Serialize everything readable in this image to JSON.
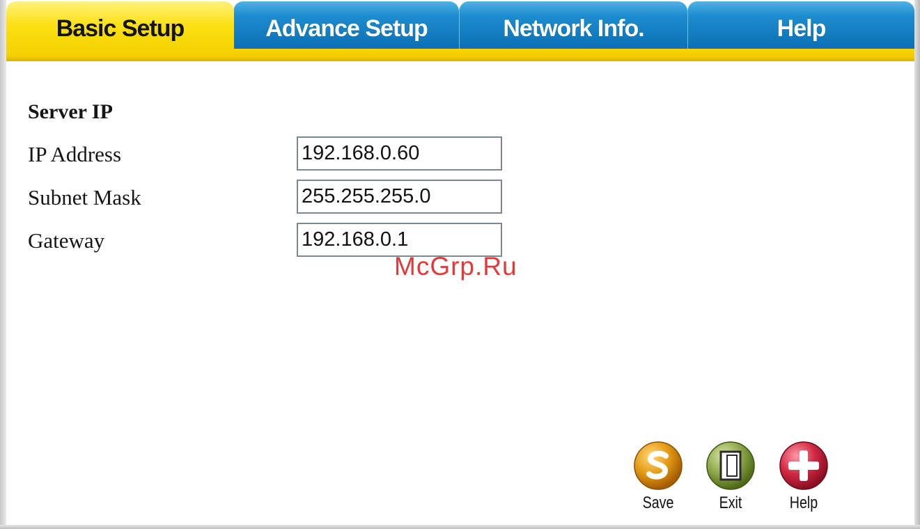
{
  "tabs": [
    {
      "label": "Basic Setup",
      "active": true
    },
    {
      "label": "Advance Setup",
      "active": false
    },
    {
      "label": "Network Info.",
      "active": false
    },
    {
      "label": "Help",
      "active": false
    }
  ],
  "section": {
    "title": "Server IP"
  },
  "fields": {
    "ip_address": {
      "label": "IP Address",
      "value": "192.168.0.60"
    },
    "subnet_mask": {
      "label": "Subnet Mask",
      "value": "255.255.255.0"
    },
    "gateway": {
      "label": "Gateway",
      "value": "192.168.0.1"
    }
  },
  "watermark": "McGrp.Ru",
  "actions": {
    "save": {
      "label": "Save",
      "icon": "save-icon",
      "color": "#e39a12"
    },
    "exit": {
      "label": "Exit",
      "icon": "exit-door-icon",
      "color": "#7f9a3a"
    },
    "help": {
      "label": "Help",
      "icon": "plus-icon",
      "color": "#c8243c"
    }
  },
  "colors": {
    "active_tab": "#fbe012",
    "inactive_tab": "#1d8ccf"
  }
}
